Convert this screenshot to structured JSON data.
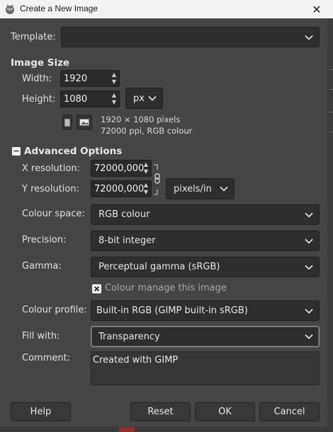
{
  "window": {
    "title": "Create a New Image",
    "close_glyph": "✕"
  },
  "template": {
    "label": "Template:",
    "value": ""
  },
  "image_size": {
    "heading": "Image Size",
    "width_label": "Width:",
    "width_value": "1920",
    "height_label": "Height:",
    "height_value": "1080",
    "unit": "px",
    "info_line1": "1920 × 1080 pixels",
    "info_line2": "72000 ppi, RGB colour"
  },
  "advanced": {
    "heading": "Advanced Options",
    "toggle_glyph": "−",
    "x_res_label": "X resolution:",
    "x_res_value": "72000,000",
    "y_res_label": "Y resolution:",
    "y_res_value": "72000,000",
    "res_unit": "pixels/in",
    "colour_space_label": "Colour space:",
    "colour_space_value": "RGB colour",
    "precision_label": "Precision:",
    "precision_value": "8-bit integer",
    "gamma_label": "Gamma:",
    "gamma_value": "Perceptual gamma (sRGB)",
    "colour_manage_label": "Colour manage this image",
    "colour_profile_label": "Colour profile:",
    "colour_profile_value": "Built-in RGB (GIMP built-in sRGB)",
    "fill_label": "Fill with:",
    "fill_value": "Transparency",
    "comment_label": "Comment:",
    "comment_value": "Created with GIMP"
  },
  "buttons": {
    "help": "Help",
    "reset": "Reset",
    "ok": "OK",
    "cancel": "Cancel"
  },
  "colors": {
    "dialog_bg": "#454545",
    "field_bg": "#2e2e2e",
    "titlebar_bg": "#f3f3f3"
  }
}
